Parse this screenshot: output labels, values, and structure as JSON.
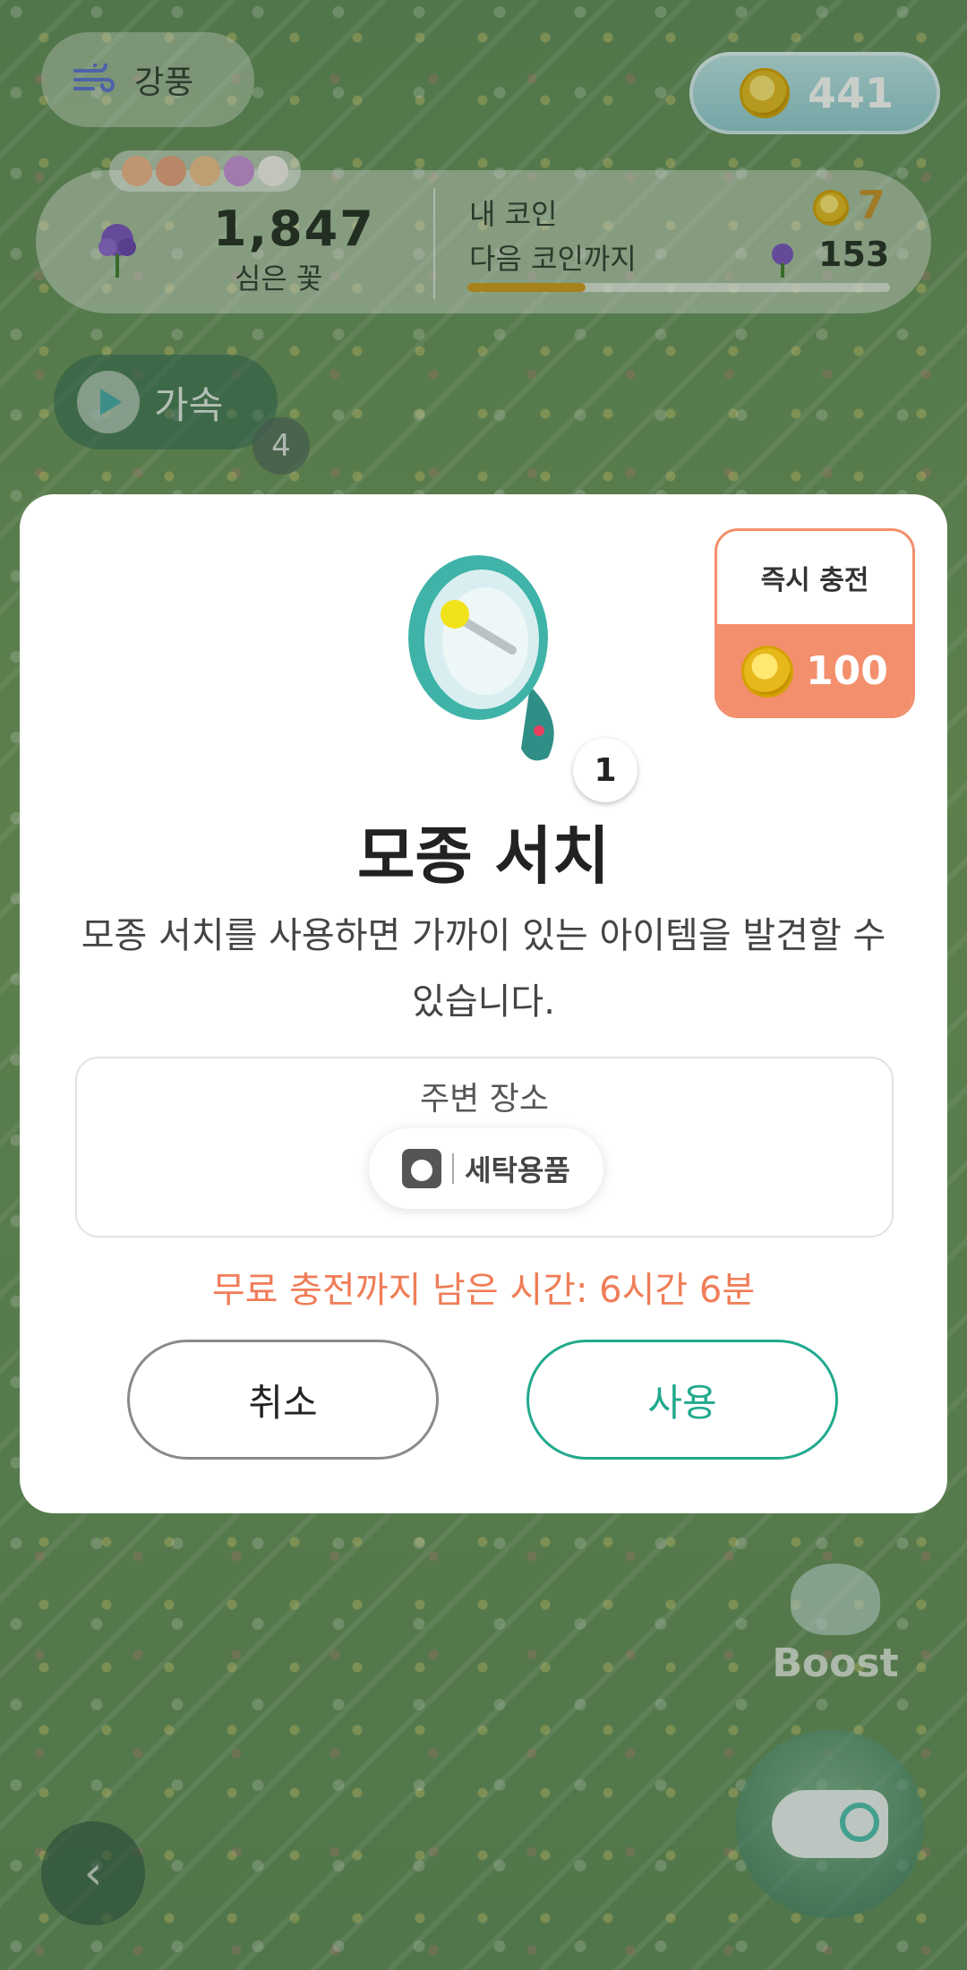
{
  "hud": {
    "wind_label": "강풍",
    "coins_total": "441",
    "planted_count": "1,847",
    "planted_label": "심은 꽃",
    "my_coin_label": "내 코인",
    "my_coin_value": "7",
    "next_coin_label": "다음 코인까지",
    "next_coin_value": "153",
    "next_coin_progress": 0.28,
    "accelerate_label": "가속",
    "accelerate_count": "4"
  },
  "background": {
    "boost_label": "Boost",
    "back_glyph": "‹"
  },
  "modal": {
    "instant_charge_label": "즉시 충전",
    "instant_charge_price": "100",
    "item_count": "1",
    "title": "모종 서치",
    "description": "모종 서치를 사용하면 가까이 있는 아이템을 발견할 수 있습니다.",
    "nearby_label": "주변 장소",
    "nearby_place": "세탁용품",
    "timer_text": "무료 충전까지 남은 시간: 6시간 6분",
    "cancel_label": "취소",
    "use_label": "사용"
  },
  "colors": {
    "accent_orange": "#f38f6c",
    "accent_green": "#21a98d",
    "coin_gold": "#e6b81c"
  },
  "icons": [
    "wind-icon",
    "coin-icon",
    "flower-icon",
    "accelerate-icon",
    "megaphone-icon",
    "washer-icon",
    "whistle-icon",
    "back-icon",
    "boost-icon"
  ]
}
